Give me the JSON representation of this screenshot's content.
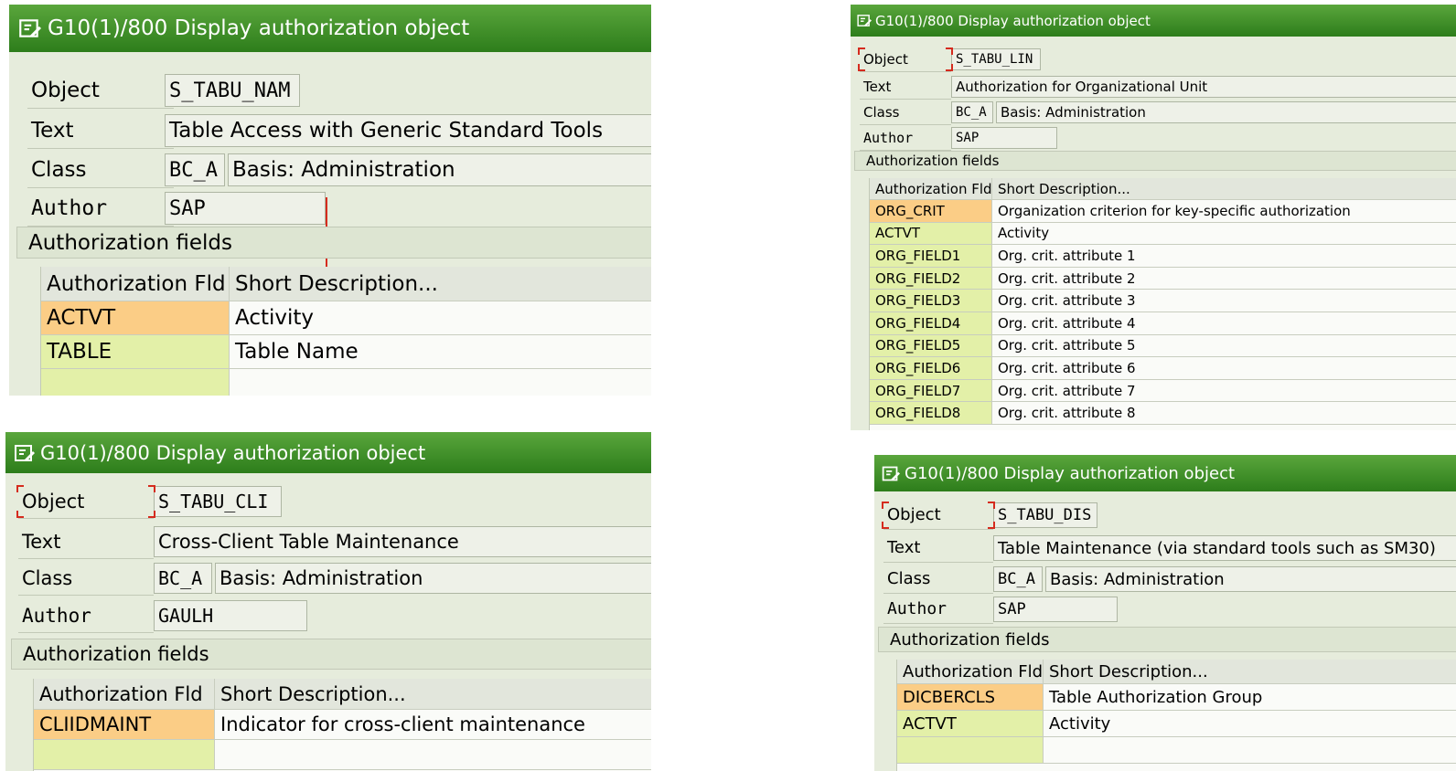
{
  "labels": {
    "object": "Object",
    "text": "Text",
    "class": "Class",
    "author": "Author",
    "section": "Authorization fields",
    "col_field": "Authorization Fld",
    "col_desc": "Short Description..."
  },
  "icons": {
    "title": "display-document-icon"
  },
  "colors": {
    "title_bar": "#3a8e26",
    "key_field": "#fbcd86",
    "field": "#e3f0a8",
    "marker": "#d52b1e"
  },
  "windows": [
    {
      "title": "G10(1)/800 Display authorization object",
      "object": "S_TABU_NAM",
      "text": "Table Access with Generic Standard Tools",
      "class_code": "BC_A",
      "class_name": "Basis: Administration",
      "author": "SAP",
      "fields": [
        {
          "field": "ACTVT",
          "desc": "Activity"
        },
        {
          "field": "TABLE",
          "desc": "Table Name"
        }
      ]
    },
    {
      "title": "G10(1)/800 Display authorization object",
      "object": "S_TABU_LIN",
      "text": "Authorization for Organizational Unit",
      "class_code": "BC_A",
      "class_name": "Basis: Administration",
      "author": "SAP",
      "fields": [
        {
          "field": "ORG_CRIT",
          "desc": "Organization criterion for key-specific authorization"
        },
        {
          "field": "ACTVT",
          "desc": "Activity"
        },
        {
          "field": "ORG_FIELD1",
          "desc": "Org. crit. attribute 1"
        },
        {
          "field": "ORG_FIELD2",
          "desc": "Org. crit. attribute 2"
        },
        {
          "field": "ORG_FIELD3",
          "desc": "Org. crit. attribute 3"
        },
        {
          "field": "ORG_FIELD4",
          "desc": "Org. crit. attribute 4"
        },
        {
          "field": "ORG_FIELD5",
          "desc": "Org. crit. attribute 5"
        },
        {
          "field": "ORG_FIELD6",
          "desc": "Org. crit. attribute 6"
        },
        {
          "field": "ORG_FIELD7",
          "desc": "Org. crit. attribute 7"
        },
        {
          "field": "ORG_FIELD8",
          "desc": "Org. crit. attribute 8"
        }
      ]
    },
    {
      "title": "G10(1)/800 Display authorization object",
      "object": "S_TABU_CLI",
      "text": "Cross-Client Table Maintenance",
      "class_code": "BC_A",
      "class_name": "Basis: Administration",
      "author": "GAULH",
      "fields": [
        {
          "field": "CLIIDMAINT",
          "desc": "Indicator for cross-client maintenance"
        }
      ]
    },
    {
      "title": "G10(1)/800 Display authorization object",
      "object": "S_TABU_DIS",
      "text": "Table Maintenance (via standard tools such as SM30)",
      "class_code": "BC_A",
      "class_name": "Basis: Administration",
      "author": "SAP",
      "fields": [
        {
          "field": "DICBERCLS",
          "desc": "Table Authorization Group"
        },
        {
          "field": "ACTVT",
          "desc": "Activity"
        }
      ]
    }
  ]
}
